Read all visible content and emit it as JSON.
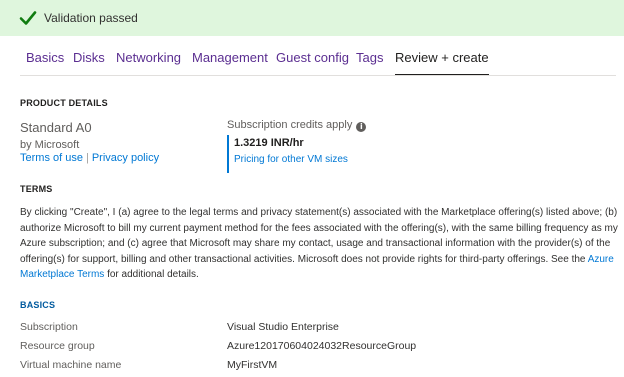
{
  "banner": {
    "message": "Validation passed",
    "icon": "check-icon",
    "color": "#107c10",
    "background": "#dff6dd"
  },
  "tabs": [
    {
      "label": "Basics",
      "active": false
    },
    {
      "label": "Disks",
      "active": false
    },
    {
      "label": "Networking",
      "active": false
    },
    {
      "label": "Management",
      "active": false
    },
    {
      "label": "Guest config",
      "active": false
    },
    {
      "label": "Tags",
      "active": false
    },
    {
      "label": "Review + create",
      "active": true
    }
  ],
  "product": {
    "heading": "PRODUCT DETAILS",
    "name": "Standard A0",
    "by": "by Microsoft",
    "terms_link": "Terms of use",
    "separator": "|",
    "privacy_link": "Privacy policy",
    "credits_label": "Subscription credits apply",
    "info_icon": "info-icon",
    "price": "1.3219 INR/hr",
    "pricing_link": "Pricing for other VM sizes"
  },
  "terms": {
    "heading": "TERMS",
    "body": "By clicking \"Create\", I (a) agree to the legal terms and privacy statement(s) associated with the Marketplace offering(s) listed above; (b) authorize Microsoft to bill my current payment method for the fees associated with the offering(s), with the same billing frequency as my Azure subscription; and (c) agree that Microsoft may share my contact, usage and transactional information with the provider(s) of the offering(s) for support, billing and other transactional activities. Microsoft does not provide rights for third-party offerings. See the ",
    "link": "Azure Marketplace Terms",
    "suffix": " for additional details."
  },
  "basics": {
    "heading": "BASICS",
    "rows": [
      {
        "label": "Subscription",
        "value": "Visual Studio Enterprise"
      },
      {
        "label": "Resource group",
        "value": "Azure120170604024032ResourceGroup"
      },
      {
        "label": "Virtual machine name",
        "value": "MyFirstVM"
      }
    ]
  },
  "colors": {
    "link": "#0078d4",
    "tab_link": "#5b2e91",
    "section_blue": "#005a9e"
  }
}
